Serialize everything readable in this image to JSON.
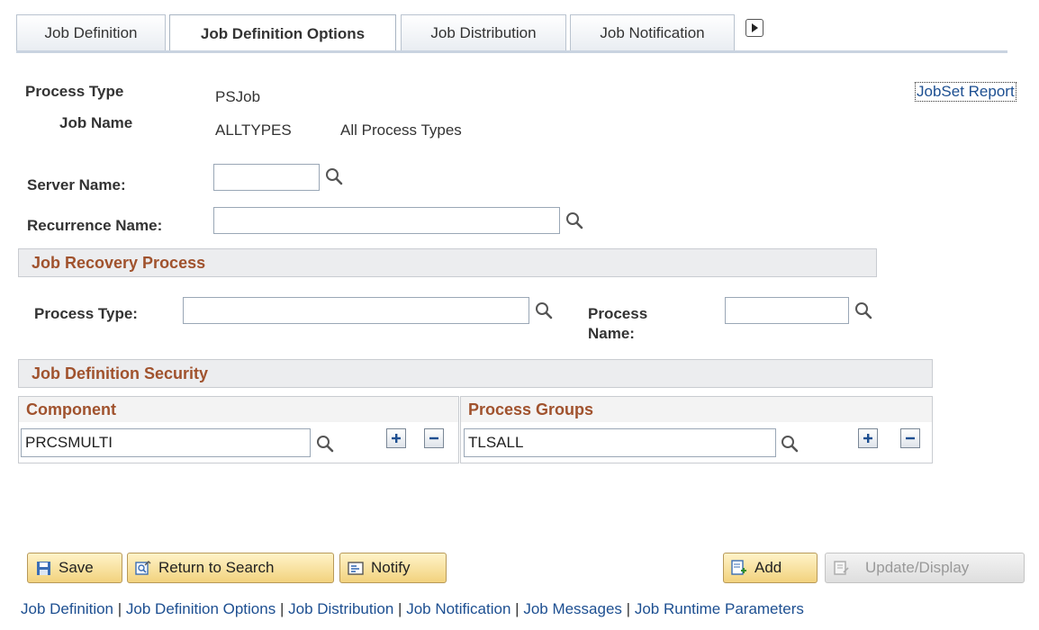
{
  "tabs": [
    {
      "label": "Job Definition",
      "active": false
    },
    {
      "label": "Job Definition Options",
      "active": true
    },
    {
      "label": "Job Distribution",
      "active": false
    },
    {
      "label": "Job Notification",
      "active": false
    }
  ],
  "header": {
    "process_type_label": "Process Type",
    "process_type_value": "PSJob",
    "job_name_label": "Job Name",
    "job_name_value": "ALLTYPES",
    "job_name_desc": "All Process Types",
    "jobset_report_link": "JobSet Report"
  },
  "fields": {
    "server_name_label": "Server Name:",
    "server_name_value": "",
    "recurrence_name_label": "Recurrence Name:",
    "recurrence_name_value": ""
  },
  "job_recovery": {
    "title": "Job Recovery Process",
    "process_type_label": "Process Type:",
    "process_type_value": "",
    "process_name_label_line1": "Process",
    "process_name_label_line2": "Name:",
    "process_name_value": ""
  },
  "security": {
    "title": "Job Definition Security",
    "component_header": "Component",
    "component_value": "PRCSMULTI",
    "process_groups_header": "Process Groups",
    "process_groups_value": "TLSALL"
  },
  "buttons": {
    "save": "Save",
    "return_to_search": "Return to Search",
    "notify": "Notify",
    "add": "Add",
    "update_display": "Update/Display"
  },
  "footer_links": [
    "Job Definition",
    "Job Definition Options",
    "Job Distribution",
    "Job Notification",
    "Job Messages",
    "Job Runtime Parameters"
  ],
  "colors": {
    "section_title": "#a0522d",
    "link": "#1d4f91",
    "button_gradient_top": "#fff3c8",
    "button_gradient_bottom": "#f2d27e"
  }
}
